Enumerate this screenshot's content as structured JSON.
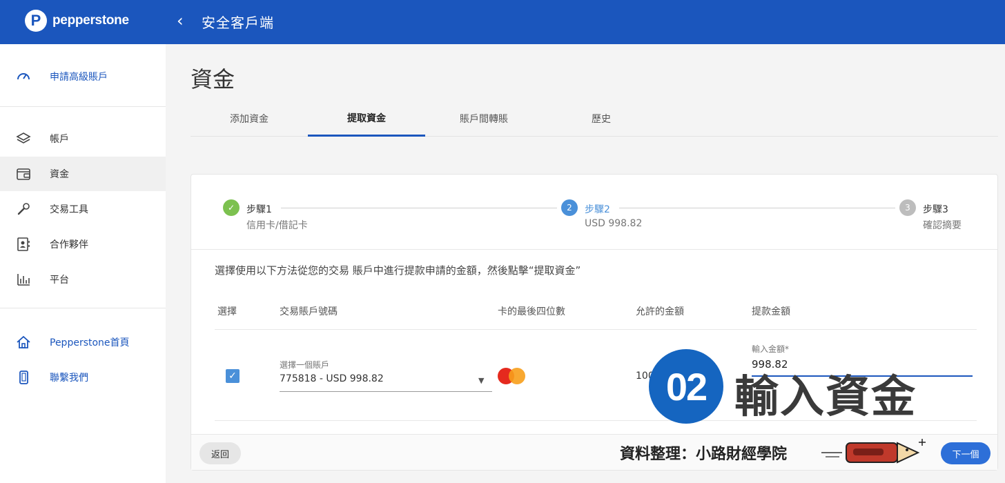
{
  "brand": {
    "name": "pepperstone",
    "badge_letter": "P",
    "color": "#1b56bd"
  },
  "header": {
    "back_icon": "chevron-left-icon",
    "title": "安全客戶端"
  },
  "sidebar": {
    "top_item": {
      "label": "申請高級賬戶",
      "icon": "gauge-icon"
    },
    "items": [
      {
        "label": "帳戶",
        "icon": "layers-icon"
      },
      {
        "label": "資金",
        "icon": "wallet-icon",
        "active": true
      },
      {
        "label": "交易工具",
        "icon": "wrench-icon"
      },
      {
        "label": "合作夥伴",
        "icon": "contact-card-icon"
      },
      {
        "label": "平台",
        "icon": "bar-chart-icon"
      }
    ],
    "bottom_items": [
      {
        "label": "Pepperstone首頁",
        "icon": "home-icon"
      },
      {
        "label": "聯繫我們",
        "icon": "phone-icon"
      }
    ]
  },
  "page": {
    "title": "資金"
  },
  "tabs": [
    {
      "label": "添加資金",
      "active": false
    },
    {
      "label": "提取資金",
      "active": true
    },
    {
      "label": "賬戶間轉賬",
      "active": false
    },
    {
      "label": "歷史",
      "active": false
    }
  ],
  "stepper": {
    "steps": [
      {
        "marker": "✓",
        "title": "步驟1",
        "subtitle": "信用卡/借記卡",
        "state": "complete"
      },
      {
        "marker": "2",
        "title": "步驟2",
        "subtitle": "USD 998.82",
        "state": "current"
      },
      {
        "marker": "3",
        "title": "步驟3",
        "subtitle": "確認摘要",
        "state": "pending"
      }
    ]
  },
  "form": {
    "instruction": "選擇使用以下方法從您的交易 賬戶中進行提款申請的金額，然後點擊“提取資金”",
    "columns": [
      "選擇",
      "交易賬戶號碼",
      "卡的最後四位數",
      "允許的金額",
      "提款金額"
    ],
    "row": {
      "checked": true,
      "select_label": "選擇一個賬戶",
      "select_value": "775818 - USD 998.82",
      "card_brand_icon": "mastercard-icon",
      "allowed_amount": "100",
      "amount_label": "輸入金額*",
      "amount_value": "998.82"
    }
  },
  "buttons": {
    "back": "返回",
    "next": "下一個"
  },
  "overlay": {
    "step_number": "02",
    "step_text": "輸入資金",
    "credit": "資料整理：小路財經學院"
  },
  "colors": {
    "primary": "#1b56bd",
    "success": "#7cc14f",
    "active_step": "#4a90d9",
    "pending_step": "#bdbdbd"
  }
}
